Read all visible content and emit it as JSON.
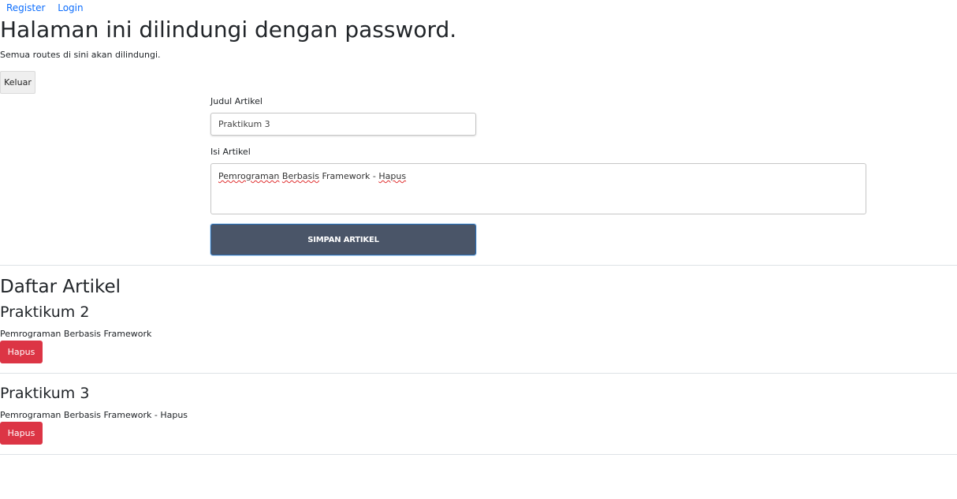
{
  "nav": {
    "register_label": "Register",
    "login_label": "Login"
  },
  "header": {
    "title": "Halaman ini dilindungi dengan password.",
    "subtitle": "Semua routes di sini akan dilindungi."
  },
  "logout_label": "Keluar",
  "form": {
    "title_label": "Judul Artikel",
    "title_value": "Praktikum 3",
    "content_label": "Isi Artikel",
    "content_parts": [
      "Pemrograman",
      " ",
      "Berbasis",
      " Framework - ",
      "Hapus"
    ],
    "submit_label": "SIMPAN ARTIKEL"
  },
  "list": {
    "heading": "Daftar Artikel",
    "articles": [
      {
        "title": "Praktikum 2",
        "content": "Pemrograman Berbasis Framework",
        "delete_label": "Hapus"
      },
      {
        "title": "Praktikum 3",
        "content": "Pemrograman Berbasis Framework - Hapus",
        "delete_label": "Hapus"
      }
    ]
  },
  "colors": {
    "link": "#0d6efd",
    "submit_bg": "#4a5568",
    "delete_bg": "#dc3545"
  }
}
